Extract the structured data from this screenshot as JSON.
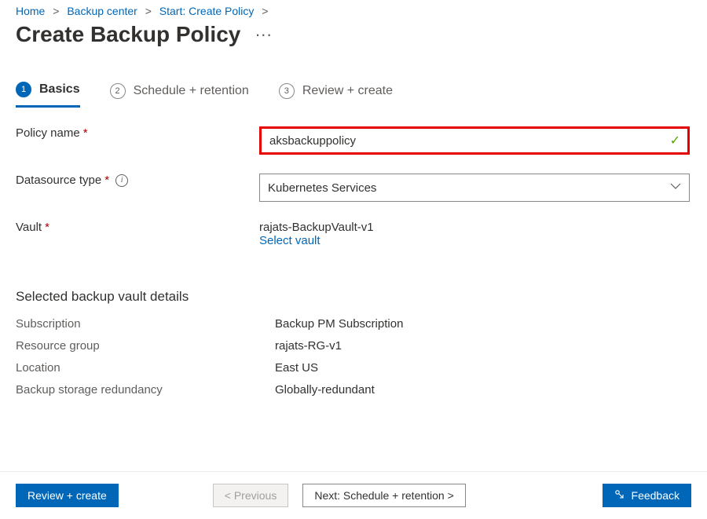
{
  "breadcrumbs": {
    "items": [
      {
        "label": "Home"
      },
      {
        "label": "Backup center"
      },
      {
        "label": "Start: Create Policy"
      }
    ],
    "separator": ">"
  },
  "page": {
    "title": "Create Backup Policy",
    "more": "···"
  },
  "tabs": {
    "items": [
      {
        "num": "1",
        "label": "Basics",
        "active": true
      },
      {
        "num": "2",
        "label": "Schedule + retention",
        "active": false
      },
      {
        "num": "3",
        "label": "Review + create",
        "active": false
      }
    ]
  },
  "form": {
    "policy_name_label": "Policy name",
    "policy_name_value": "aksbackuppolicy",
    "datasource_label": "Datasource type",
    "datasource_value": "Kubernetes Services",
    "vault_label": "Vault",
    "vault_value": "rajats-BackupVault-v1",
    "vault_select_link": "Select vault"
  },
  "vault_details": {
    "heading": "Selected backup vault details",
    "rows": [
      {
        "k": "Subscription",
        "v": "Backup PM Subscription"
      },
      {
        "k": "Resource group",
        "v": "rajats-RG-v1"
      },
      {
        "k": "Location",
        "v": "East US"
      },
      {
        "k": "Backup storage redundancy",
        "v": "Globally-redundant"
      }
    ]
  },
  "footer": {
    "review": "Review + create",
    "prev": "< Previous",
    "next": "Next: Schedule + retention >",
    "feedback": "Feedback"
  },
  "icons": {
    "required": "*",
    "info": "i",
    "check": "✓",
    "chevron_down": "⌄",
    "feedback": "⚐"
  }
}
